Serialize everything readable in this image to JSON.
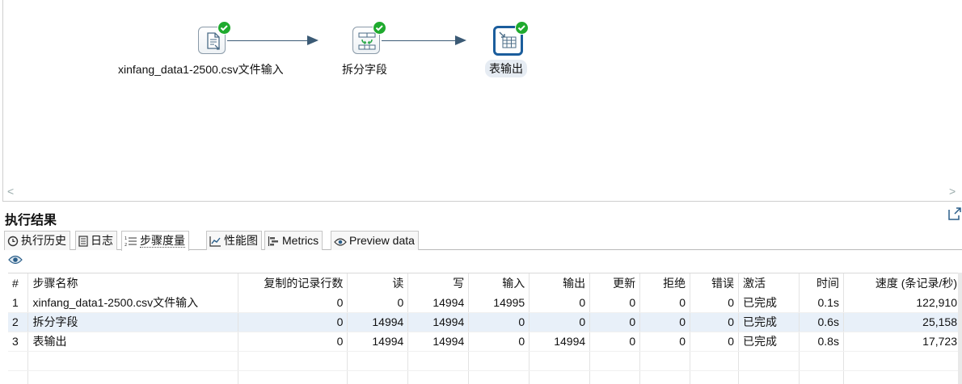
{
  "canvas": {
    "steps": [
      {
        "label": "xinfang_data1-2500.csv文件输入",
        "icon": "csv-file-input-icon",
        "status": "check-icon"
      },
      {
        "label": "拆分字段",
        "icon": "split-fields-icon",
        "status": "check-icon"
      },
      {
        "label": "表输出",
        "icon": "table-output-icon",
        "status": "check-icon"
      }
    ],
    "scroll_left": "<",
    "scroll_right": ">"
  },
  "results": {
    "title": "执行结果",
    "tabs": [
      {
        "label": "执行历史",
        "icon": "clock-icon"
      },
      {
        "label": "日志",
        "icon": "log-icon"
      },
      {
        "label": "步骤度量",
        "icon": "list-numbered-icon"
      },
      {
        "label": "性能图",
        "icon": "chart-icon"
      },
      {
        "label": "Metrics",
        "icon": "metrics-icon"
      },
      {
        "label": "Preview data",
        "icon": "eye-icon"
      }
    ],
    "active_tab": "步骤度量",
    "columns": [
      "#",
      "步骤名称",
      "复制的记录行数",
      "读",
      "写",
      "输入",
      "输出",
      "更新",
      "拒绝",
      "错误",
      "激活",
      "时间",
      "速度 (条记录/秒)"
    ],
    "rows": [
      [
        "1",
        "xinfang_data1-2500.csv文件输入",
        "0",
        "0",
        "14994",
        "14995",
        "0",
        "0",
        "0",
        "0",
        "已完成",
        "0.1s",
        "122,910"
      ],
      [
        "2",
        "拆分字段",
        "0",
        "14994",
        "14994",
        "0",
        "0",
        "0",
        "0",
        "0",
        "已完成",
        "0.6s",
        "25,158"
      ],
      [
        "3",
        "表输出",
        "0",
        "14994",
        "14994",
        "0",
        "14994",
        "0",
        "0",
        "0",
        "已完成",
        "0.8s",
        "17,723"
      ]
    ]
  },
  "colors": {
    "check": "#1faa2e",
    "hop": "#3b5a75",
    "selected_border": "#1b5d9c"
  }
}
